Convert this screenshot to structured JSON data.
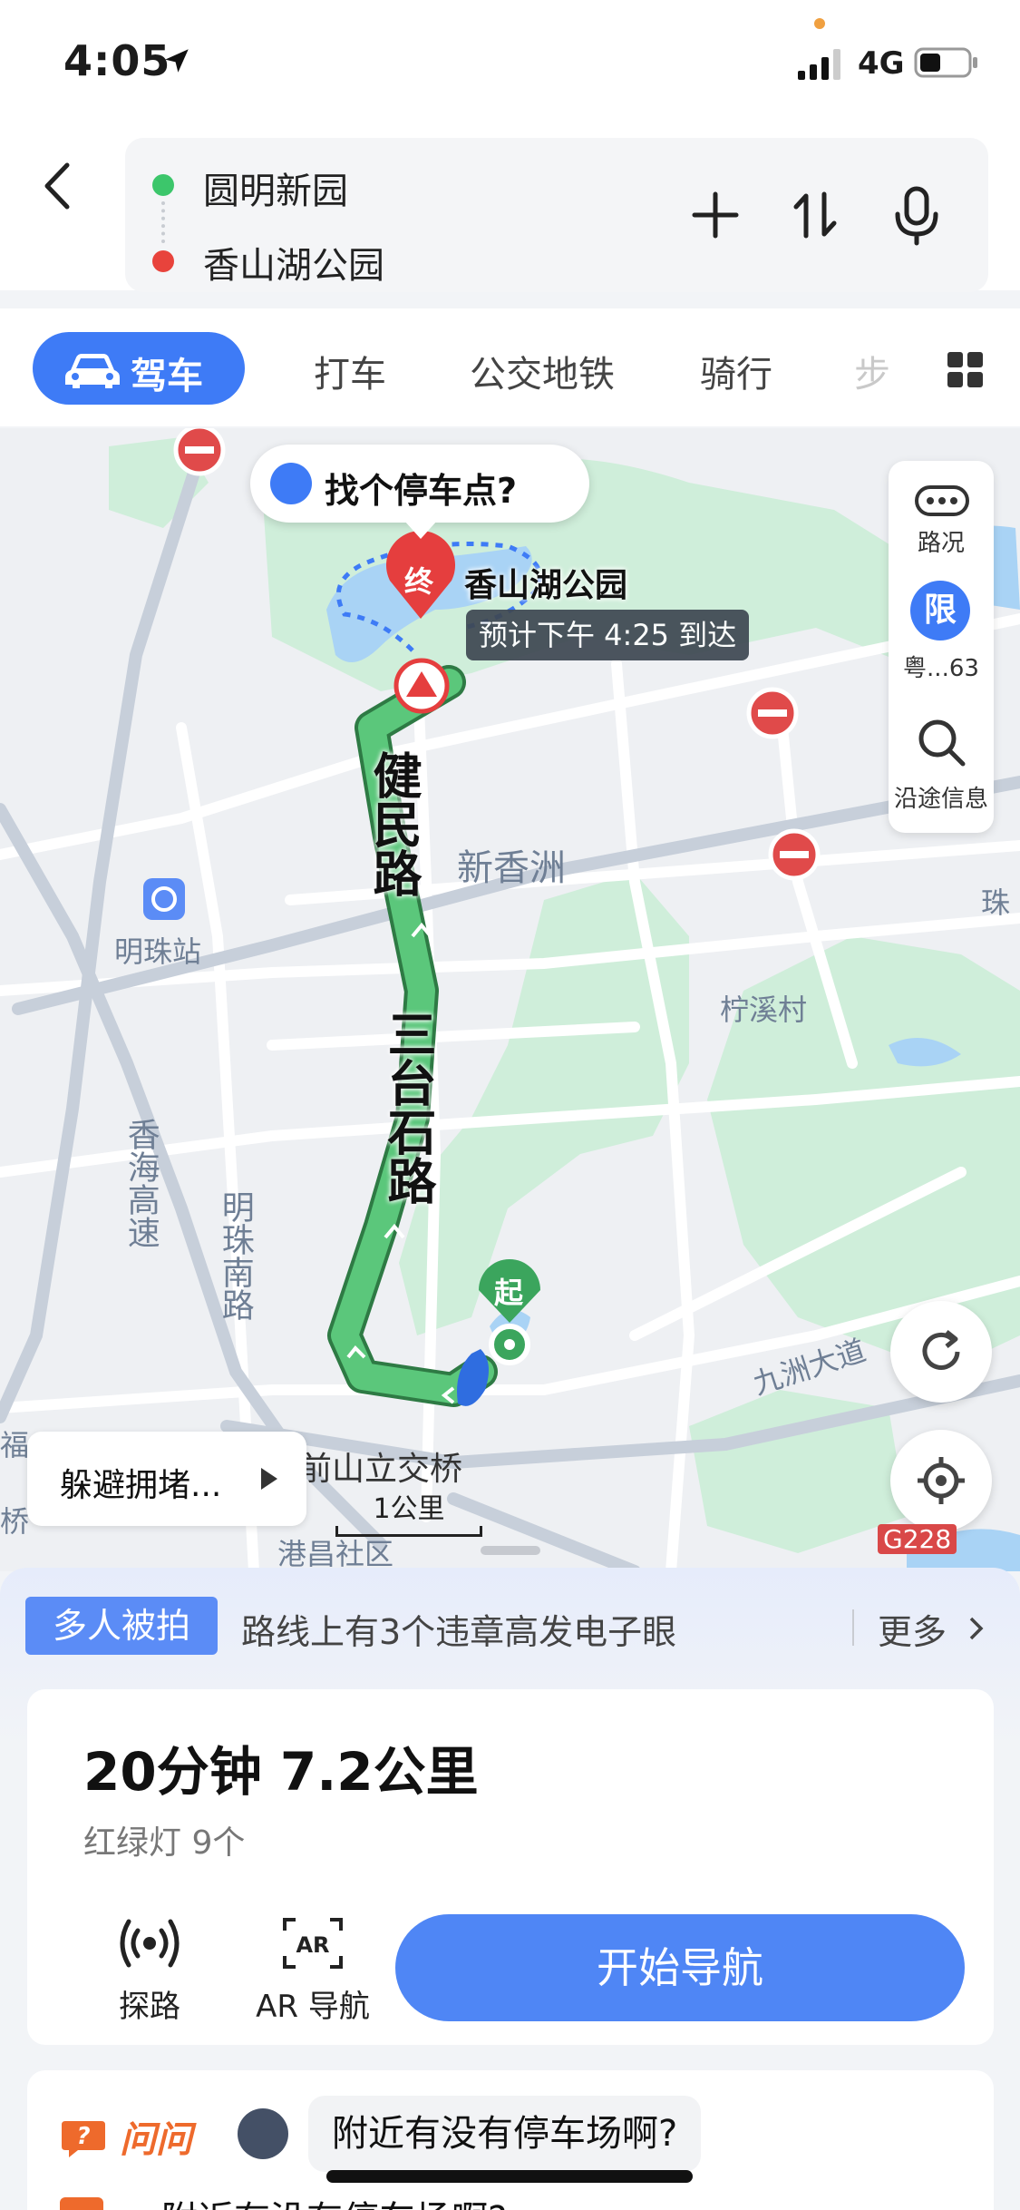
{
  "status": {
    "time": "4:05",
    "network": "4G"
  },
  "route": {
    "start": "圆明新园",
    "end": "香山湖公园"
  },
  "tabs": {
    "active": "驾车",
    "items": [
      "打车",
      "公交地铁",
      "骑行",
      "步"
    ]
  },
  "map": {
    "parking_prompt": "找个停车点?",
    "destination": "香山湖公园",
    "eta": "预计下午 4:25 到达",
    "start_marker": "起",
    "end_marker": "终",
    "roads": {
      "jianmin": "健民路",
      "santaishi": "三台石路",
      "xianghai": "香海高速",
      "mingzhu_south": "明珠南路",
      "jiuzhou": "九洲大道",
      "qianshan": "前山立交桥"
    },
    "places": {
      "xinxiangzhou": "新香洲",
      "ningxicun": "柠溪村",
      "mingzhu_station": "明珠站",
      "gangchang": "港昌社区",
      "zhu": "珠",
      "fu": "福",
      "qiao": "桥"
    },
    "side": {
      "traffic": "路况",
      "restrict_icon": "限",
      "restrict": "粤...63",
      "along": "沿途信息"
    },
    "avoid": "躲避拥堵...",
    "scale": "1公里",
    "highway_tag": "G228"
  },
  "alert": {
    "badge": "多人被拍",
    "text": "路线上有3个违章高发电子眼",
    "more": "更多"
  },
  "summary": {
    "duration": "20分钟  7.2公里",
    "lights": "红绿灯 9个"
  },
  "actions": {
    "explore": "探路",
    "ar": "AR 导航",
    "start_nav": "开始导航"
  },
  "ask": {
    "logo": "问问",
    "question": "附近有没有停车场啊?",
    "next": "附近有没有停车场啊?"
  },
  "colors": {
    "accent": "#3e7bf6",
    "route": "#4cb86a",
    "park": "#cfeeda",
    "water": "#a9d3f5"
  }
}
